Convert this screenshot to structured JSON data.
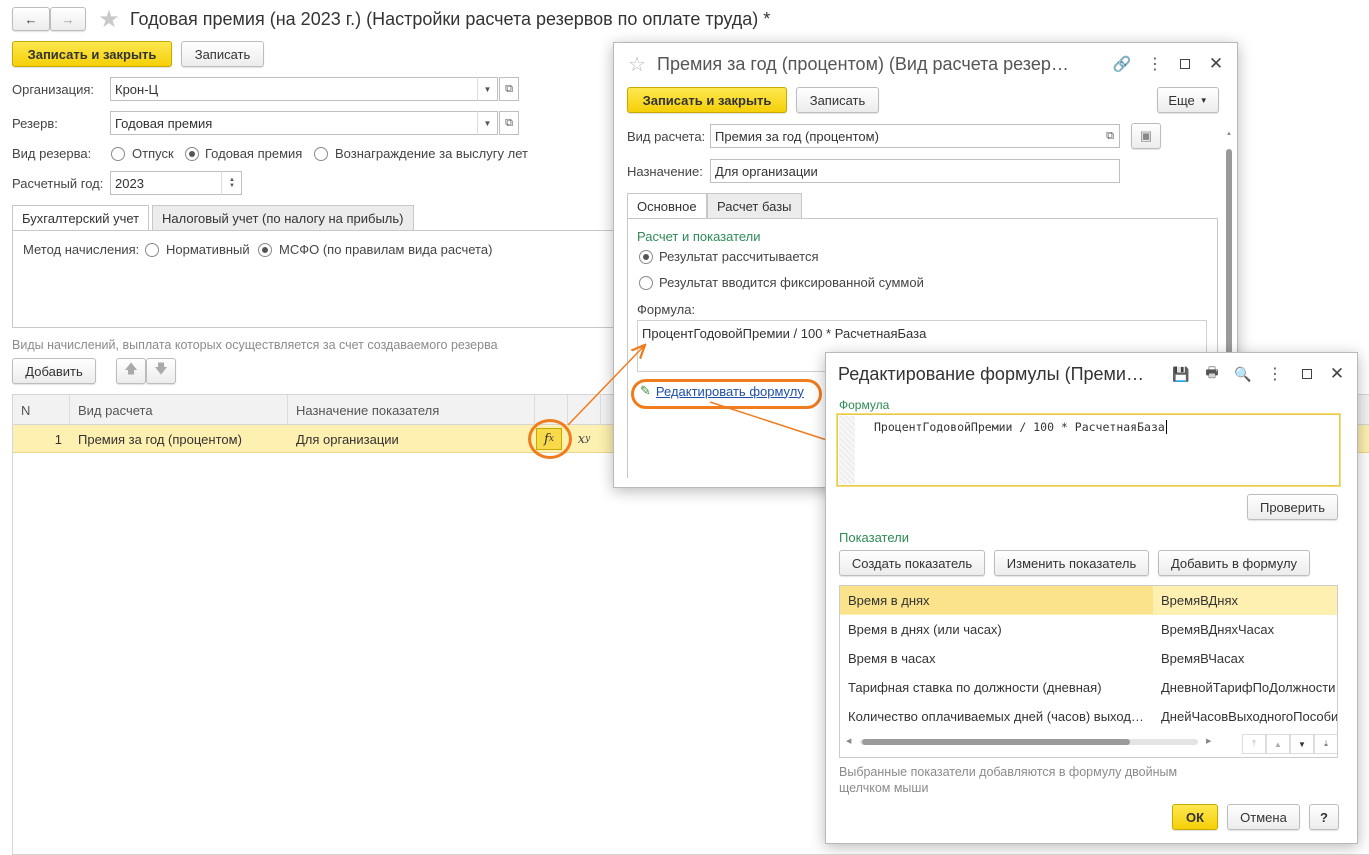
{
  "main": {
    "title": "Годовая премия (на 2023 г.) (Настройки расчета резервов по оплате труда) *",
    "save_close_label": "Записать и закрыть",
    "save_label": "Записать",
    "org_label": "Организация:",
    "org_value": "Крон-Ц",
    "reserve_label": "Резерв:",
    "reserve_value": "Годовая премия",
    "reserve_type_label": "Вид резерва:",
    "reserve_type_options": [
      "Отпуск",
      "Годовая премия",
      "Вознаграждение за выслугу лет"
    ],
    "reserve_type_selected": 1,
    "year_label": "Расчетный год:",
    "year_value": "2023",
    "tabs": [
      "Бухгалтерский учет",
      "Налоговый учет (по налогу на прибыль)"
    ],
    "method_label": "Метод начисления:",
    "method_options": [
      "Нормативный",
      "МСФО (по правилам вида расчета)"
    ],
    "method_selected": 1,
    "accruals_caption": "Виды начислений, выплата которых осуществляется за счет создаваемого резерва",
    "add_label": "Добавить",
    "table": {
      "headers": [
        "N",
        "Вид расчета",
        "Назначение показателя"
      ],
      "rows": [
        {
          "n": "1",
          "kind": "Премия за год (процентом)",
          "purpose": "Для организации"
        }
      ]
    }
  },
  "calc_window": {
    "title": "Премия за год (процентом) (Вид расчета резер…",
    "save_close_label": "Записать и закрыть",
    "save_label": "Записать",
    "more_label": "Еще",
    "kind_label": "Вид расчета:",
    "kind_value": "Премия за год (процентом)",
    "purpose_label": "Назначение:",
    "purpose_value": "Для организации",
    "tabs": [
      "Основное",
      "Расчет базы"
    ],
    "section_label": "Расчет и показатели",
    "result_options": [
      "Результат рассчитывается",
      "Результат вводится фиксированной суммой"
    ],
    "result_selected": 0,
    "formula_label": "Формула:",
    "formula_value": "ПроцентГодовойПремии / 100 * РасчетнаяБаза",
    "edit_formula_link": "Редактировать формулу"
  },
  "formula_window": {
    "title": "Редактирование формулы (Преми…",
    "formula_label": "Формула",
    "formula_value": "ПроцентГодовойПремии / 100 * РасчетнаяБаза",
    "check_label": "Проверить",
    "indicators_label": "Показатели",
    "create_label": "Создать показатель",
    "change_label": "Изменить показатель",
    "add_to_formula_label": "Добавить в формулу",
    "indicators": [
      {
        "name": "Время в днях",
        "id": "ВремяВДнях"
      },
      {
        "name": "Время в днях (или часах)",
        "id": "ВремяВДняхЧасах"
      },
      {
        "name": "Время в часах",
        "id": "ВремяВЧасах"
      },
      {
        "name": "Тарифная ставка по должности (дневная)",
        "id": "ДневнойТарифПоДолжности"
      },
      {
        "name": "Количество оплачиваемых дней (часов) выход…",
        "id": "ДнейЧасовВыходногоПособи"
      }
    ],
    "hint": "Выбранные показатели добавляются в формулу двойным щелчком мыши",
    "ok_label": "ОК",
    "cancel_label": "Отмена",
    "help_label": "?"
  },
  "colors": {
    "accent_yellow": "#f5d007",
    "highlight_row": "#fdf0b0",
    "annotation_orange": "#f07c1e",
    "link_blue": "#1f4ea8",
    "section_green": "#2e8b57"
  }
}
